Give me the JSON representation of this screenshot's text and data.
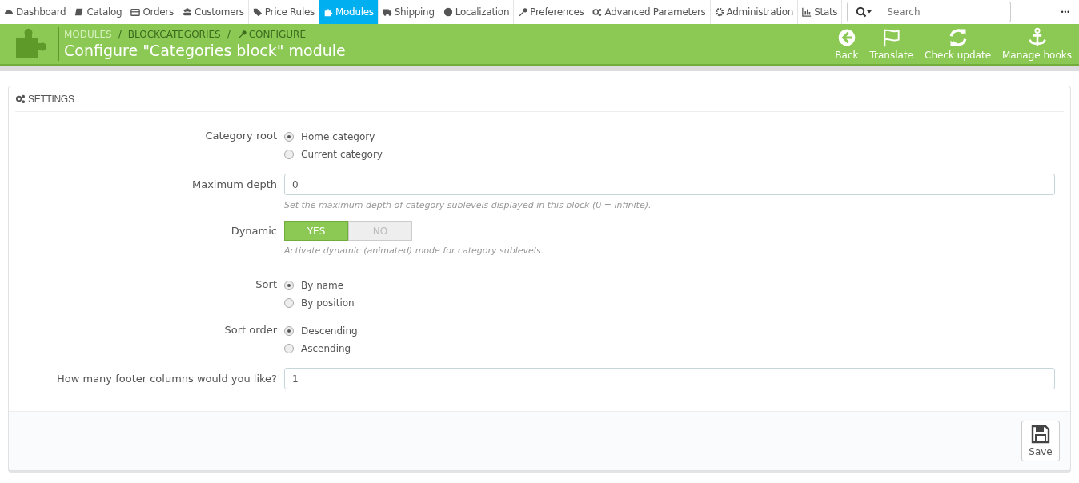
{
  "nav": {
    "items": [
      {
        "label": "Dashboard",
        "selected": false
      },
      {
        "label": "Catalog",
        "selected": false
      },
      {
        "label": "Orders",
        "selected": false
      },
      {
        "label": "Customers",
        "selected": false
      },
      {
        "label": "Price Rules",
        "selected": false
      },
      {
        "label": "Modules",
        "selected": true
      },
      {
        "label": "Shipping",
        "selected": false
      },
      {
        "label": "Localization",
        "selected": false
      },
      {
        "label": "Preferences",
        "selected": false
      },
      {
        "label": "Advanced Parameters",
        "selected": false
      },
      {
        "label": "Administration",
        "selected": false
      },
      {
        "label": "Stats",
        "selected": false
      }
    ],
    "search": {
      "placeholder": "Search"
    },
    "more": "•••"
  },
  "header": {
    "breadcrumb": [
      "MODULES",
      "BLOCKCATEGORIES",
      "CONFIGURE"
    ],
    "separator": "/",
    "title": "Configure \"Categories block\" module",
    "actions": [
      "Back",
      "Translate",
      "Check update",
      "Manage hooks"
    ]
  },
  "panel": {
    "title": "SETTINGS",
    "fields": [
      {
        "kind": "radio",
        "label": "Category root",
        "options": [
          {
            "label": "Home category",
            "selected": true
          },
          {
            "label": "Current category",
            "selected": false
          }
        ]
      },
      {
        "kind": "text",
        "label": "Maximum depth",
        "value": "0",
        "help": "Set the maximum depth of category sublevels displayed in this block (0 = infinite)."
      },
      {
        "kind": "switch",
        "label": "Dynamic",
        "options": [
          {
            "label": "YES",
            "selected": true
          },
          {
            "label": "NO",
            "selected": false
          }
        ],
        "help": "Activate dynamic (animated) mode for category sublevels."
      },
      {
        "kind": "radio",
        "label": "Sort",
        "options": [
          {
            "label": "By name",
            "selected": true
          },
          {
            "label": "By position",
            "selected": false
          }
        ]
      },
      {
        "kind": "radio",
        "label": "Sort order",
        "options": [
          {
            "label": "Descending",
            "selected": true
          },
          {
            "label": "Ascending",
            "selected": false
          }
        ]
      },
      {
        "kind": "text",
        "label": "How many footer columns would you like?",
        "value": "1"
      }
    ],
    "save": "Save"
  }
}
